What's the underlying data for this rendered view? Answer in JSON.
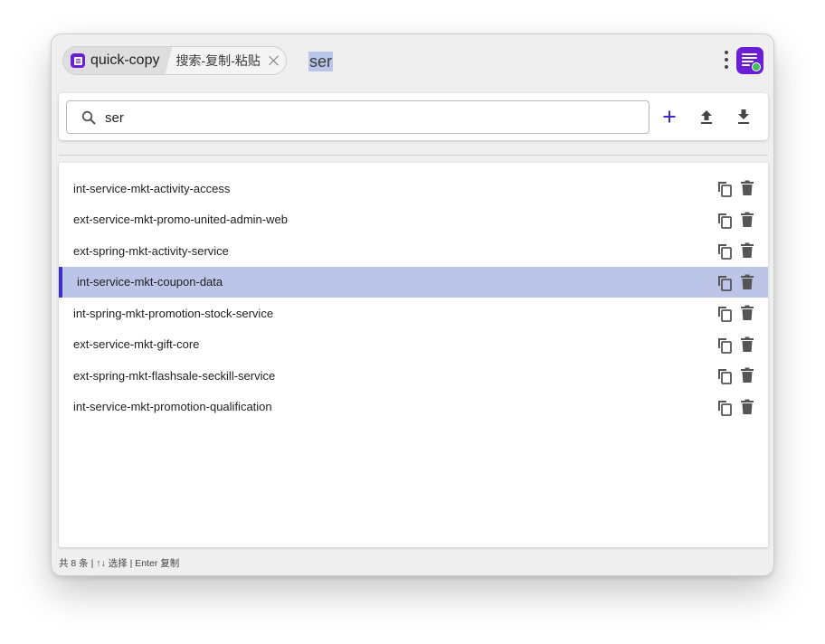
{
  "header": {
    "app_name": "quick-copy",
    "task_label": "搜索-复制-粘贴",
    "query": "ser"
  },
  "search": {
    "value": "ser",
    "placeholder": ""
  },
  "icons": {
    "app": "quick-copy-app-icon",
    "close": "close-icon",
    "more": "more-vertical-icon",
    "logo": "app-logo-icon",
    "search": "search-icon",
    "add": "plus-icon",
    "upload": "upload-icon",
    "download": "download-icon",
    "copy": "copy-icon",
    "delete": "trash-icon"
  },
  "colors": {
    "accent": "#6a1fd6",
    "add_button": "#3b2bd0",
    "selected_row": "#bcc5e8",
    "selected_marker": "#3b2bd0"
  },
  "items": [
    {
      "label": "int-service-mkt-activity-access",
      "selected": false
    },
    {
      "label": "ext-service-mkt-promo-united-admin-web",
      "selected": false
    },
    {
      "label": "ext-spring-mkt-activity-service",
      "selected": false
    },
    {
      "label": "int-service-mkt-coupon-data",
      "selected": true
    },
    {
      "label": "int-spring-mkt-promotion-stock-service",
      "selected": false
    },
    {
      "label": "ext-service-mkt-gift-core",
      "selected": false
    },
    {
      "label": "ext-spring-mkt-flashsale-seckill-service",
      "selected": false
    },
    {
      "label": "int-service-mkt-promotion-qualification",
      "selected": false
    }
  ],
  "status": {
    "text": "共 8 条 | ↑↓ 选择 | Enter 复制"
  }
}
